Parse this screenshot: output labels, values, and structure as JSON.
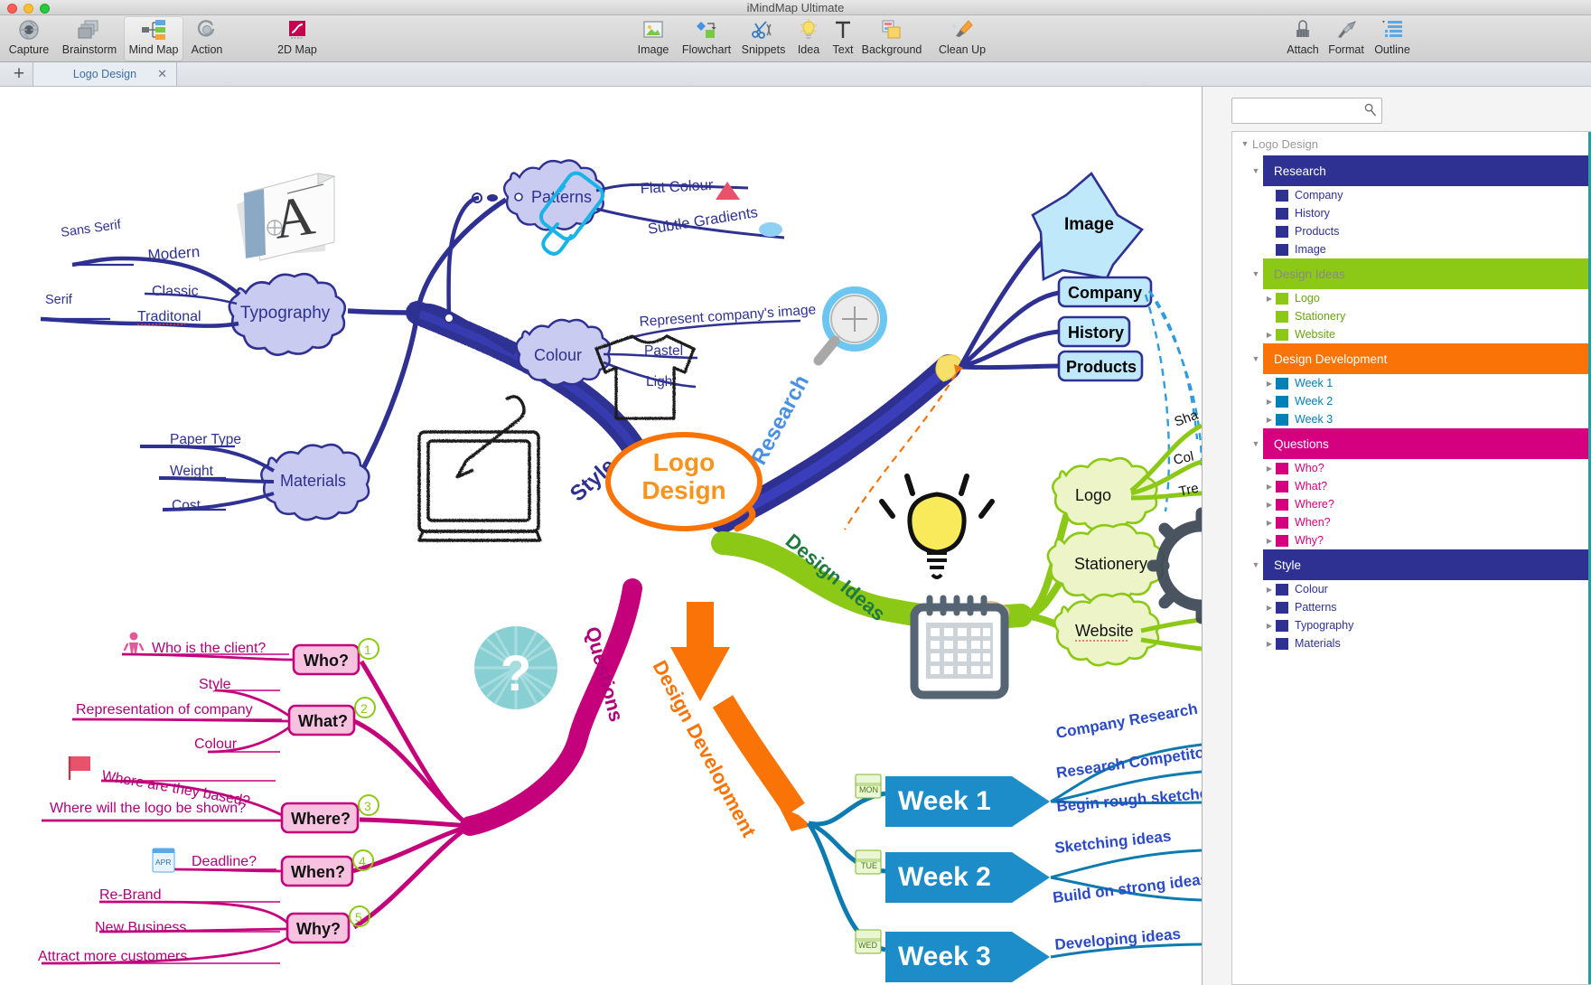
{
  "window": {
    "title": "iMindMap Ultimate"
  },
  "toolbar": {
    "left_items": [
      {
        "label": "Capture",
        "icon": "camera-aperture-icon",
        "active": false
      },
      {
        "label": "Brainstorm",
        "icon": "stacked-cards-icon",
        "active": false
      },
      {
        "label": "Mind Map",
        "icon": "mindmap-nodes-icon",
        "active": true
      },
      {
        "label": "Action",
        "icon": "action-swirl-icon",
        "active": false
      },
      {
        "label": "2D Map",
        "icon": "2d-map-icon",
        "active": false
      }
    ],
    "center_items": [
      {
        "label": "Image",
        "icon": "image-icon"
      },
      {
        "label": "Flowchart",
        "icon": "flowchart-icon"
      },
      {
        "label": "Snippets",
        "icon": "scissors-icon"
      },
      {
        "label": "Idea",
        "icon": "lightbulb-icon"
      },
      {
        "label": "Text",
        "icon": "text-t-icon"
      },
      {
        "label": "Background",
        "icon": "background-icon"
      },
      {
        "label": "Clean Up",
        "icon": "broom-icon"
      }
    ],
    "right_items": [
      {
        "label": "Attach",
        "icon": "paperclip-icon"
      },
      {
        "label": "Format",
        "icon": "paintbrush-icon"
      },
      {
        "label": "Outline",
        "icon": "outline-list-icon"
      }
    ]
  },
  "tabs": {
    "new_tab_glyph": "+",
    "items": [
      {
        "label": "Logo Design",
        "close_glyph": "✕",
        "active": true
      }
    ]
  },
  "search": {
    "value": "",
    "placeholder": "",
    "icon": "magnifier-icon"
  },
  "outline": {
    "root": {
      "label": "Logo  Design",
      "expand_glyph": "▼"
    },
    "sections": [
      {
        "label": "Research",
        "color": "#2e3192",
        "text_color": "#ffffff",
        "expand_glyph": "▼",
        "children": [
          {
            "label": "Company",
            "swatch": "#2e3192",
            "text_color": "#2e3192",
            "expand_glyph": ""
          },
          {
            "label": "History",
            "swatch": "#2e3192",
            "text_color": "#2e3192",
            "expand_glyph": ""
          },
          {
            "label": "Products",
            "swatch": "#2e3192",
            "text_color": "#2e3192",
            "expand_glyph": ""
          },
          {
            "label": "Image",
            "swatch": "#2e3192",
            "text_color": "#2e3192",
            "expand_glyph": ""
          }
        ]
      },
      {
        "label": "Design Ideas",
        "color": "#8cc816",
        "text_color": "#8a8a8a",
        "expand_glyph": "▼",
        "children": [
          {
            "label": "Logo",
            "swatch": "#8cc816",
            "text_color": "#6aa30f",
            "expand_glyph": "▶"
          },
          {
            "label": "Stationery",
            "swatch": "#8cc816",
            "text_color": "#6aa30f",
            "expand_glyph": ""
          },
          {
            "label": "Website",
            "swatch": "#8cc816",
            "text_color": "#6aa30f",
            "expand_glyph": "▶"
          }
        ]
      },
      {
        "label": "Design Development",
        "color": "#f97306",
        "text_color": "#ffffff",
        "expand_glyph": "▼",
        "children": [
          {
            "label": "Week 1",
            "swatch": "#0280b8",
            "text_color": "#0280b8",
            "expand_glyph": "▶"
          },
          {
            "label": "Week 2",
            "swatch": "#0280b8",
            "text_color": "#0280b8",
            "expand_glyph": "▶"
          },
          {
            "label": "Week 3",
            "swatch": "#0280b8",
            "text_color": "#0280b8",
            "expand_glyph": "▶"
          }
        ]
      },
      {
        "label": "Questions",
        "color": "#d4007f",
        "text_color": "#ffffff",
        "expand_glyph": "▼",
        "children": [
          {
            "label": "Who?",
            "swatch": "#d4007f",
            "text_color": "#d4007f",
            "expand_glyph": "▶"
          },
          {
            "label": "What?",
            "swatch": "#d4007f",
            "text_color": "#d4007f",
            "expand_glyph": "▶"
          },
          {
            "label": "Where?",
            "swatch": "#d4007f",
            "text_color": "#d4007f",
            "expand_glyph": "▶"
          },
          {
            "label": "When?",
            "swatch": "#d4007f",
            "text_color": "#d4007f",
            "expand_glyph": "▶"
          },
          {
            "label": "Why?",
            "swatch": "#d4007f",
            "text_color": "#d4007f",
            "expand_glyph": "▶"
          }
        ]
      },
      {
        "label": "Style",
        "color": "#2e3192",
        "text_color": "#ffffff",
        "expand_glyph": "▼",
        "children": [
          {
            "label": "Colour",
            "swatch": "#2e3192",
            "text_color": "#2e3192",
            "expand_glyph": "▶"
          },
          {
            "label": "Patterns",
            "swatch": "#2e3192",
            "text_color": "#2e3192",
            "expand_glyph": "▶"
          },
          {
            "label": "Typography",
            "swatch": "#2e3192",
            "text_color": "#2e3192",
            "expand_glyph": "▶"
          },
          {
            "label": "Materials",
            "swatch": "#2e3192",
            "text_color": "#2e3192",
            "expand_glyph": "▶"
          }
        ]
      }
    ]
  },
  "mindmap": {
    "center": {
      "line1": "Logo",
      "line2": "Design",
      "color": "#f97306"
    },
    "branches": [
      {
        "label": "Style",
        "color": "#2e3192"
      },
      {
        "label": "Research",
        "color": "#4a90e2"
      },
      {
        "label": "Design Ideas",
        "color": "#1f7a3f"
      },
      {
        "label": "Design Development",
        "color": "#f97306"
      },
      {
        "label": "Questions",
        "color": "#b0007a"
      }
    ],
    "style_branch": {
      "nodes": [
        {
          "label": "Patterns",
          "children": [
            "Flat Colour",
            "Subtle Gradients"
          ]
        },
        {
          "label": "Colour",
          "children": [
            "Represent company's image",
            "Pastel",
            "Light"
          ]
        },
        {
          "label": "Typography",
          "children": [
            "Sans Serif",
            "Modern",
            "Classic",
            "Traditonal",
            "Serif"
          ]
        },
        {
          "label": "Materials",
          "children": [
            "Paper Type",
            "Weight",
            "Cost"
          ]
        }
      ]
    },
    "research_branch": {
      "nodes": [
        "Image",
        "Company",
        "History",
        "Products"
      ]
    },
    "design_ideas_branch": {
      "nodes": [
        "Logo",
        "Stationery",
        "Website"
      ],
      "sub_labels": [
        "Sha",
        "Col",
        "Tre"
      ]
    },
    "design_development_branch": {
      "weeks": [
        {
          "label": "Week 1",
          "day": "MON",
          "children": [
            "Company Research",
            "Research Competitors",
            "Begin rough sketches"
          ]
        },
        {
          "label": "Week 2",
          "day": "TUE",
          "children": [
            "Sketching ideas",
            "Build on strong ideas"
          ]
        },
        {
          "label": "Week 3",
          "day": "WED",
          "children": [
            "Developing ideas"
          ]
        }
      ]
    },
    "questions_branch": {
      "items": [
        {
          "label": "Who?",
          "number": "1",
          "children": [
            "Who is the client?"
          ],
          "icon": "person-icon"
        },
        {
          "label": "What?",
          "number": "2",
          "children": [
            "Style",
            "Representation of company",
            "Colour"
          ]
        },
        {
          "label": "Where?",
          "number": "3",
          "children": [
            "Where are they based?",
            "Where will the logo be shown?"
          ],
          "icon": "flag-icon"
        },
        {
          "label": "When?",
          "number": "4",
          "children": [
            "Deadline?"
          ],
          "icon": "calendar-apr-icon"
        },
        {
          "label": "Why?",
          "number": "5",
          "children": [
            "Re-Brand",
            "New Business",
            "Attract more customers"
          ]
        }
      ]
    },
    "floating_icons": [
      {
        "name": "letter-A-page-icon"
      },
      {
        "name": "paint-roller-icon"
      },
      {
        "name": "tshirt-icon"
      },
      {
        "name": "magnifier-plus-icon"
      },
      {
        "name": "lightbulb-icon"
      },
      {
        "name": "graphics-tablet-icon"
      },
      {
        "name": "question-mark-badge-icon"
      },
      {
        "name": "calendar-icon"
      }
    ]
  }
}
